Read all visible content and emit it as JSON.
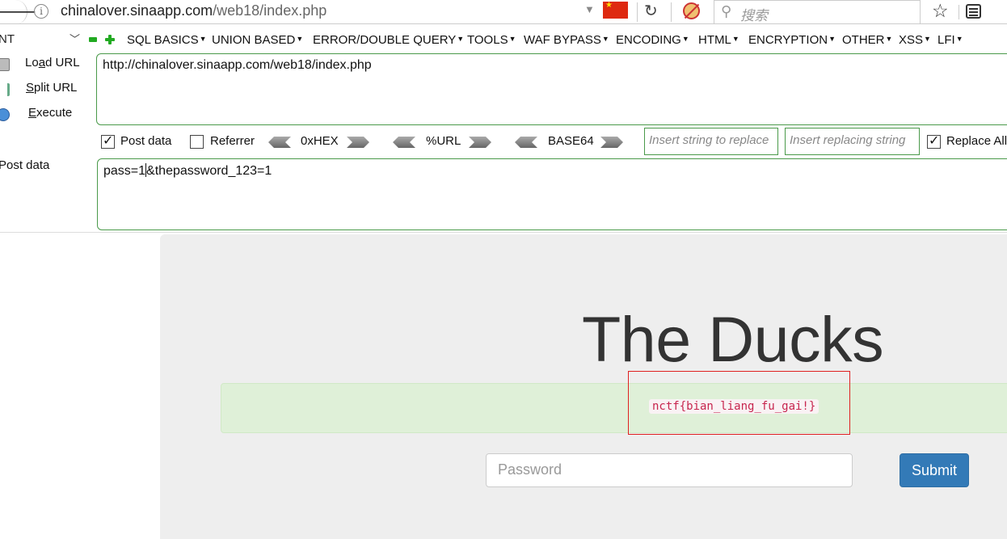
{
  "browser": {
    "url_host": "chinalover.sinaapp.com",
    "url_path": "/web18/index.php",
    "search_placeholder": "搜索"
  },
  "hackbar": {
    "select_value": "NT",
    "menus": [
      "SQL BASICS",
      "UNION BASED",
      "ERROR/DOUBLE QUERY",
      "TOOLS",
      "WAF BYPASS",
      "ENCODING",
      "HTML",
      "ENCRYPTION",
      "OTHER",
      "XSS",
      "LFI"
    ],
    "actions": {
      "load": {
        "pre": "Lo",
        "ul": "a",
        "post": "d URL"
      },
      "split": {
        "pre": "",
        "ul": "S",
        "post": "plit URL"
      },
      "execute": {
        "pre": "",
        "ul": "E",
        "post": "xecute"
      }
    },
    "url_value": "http://chinalover.sinaapp.com/web18/index.php",
    "options": {
      "post_data_label": "Post data",
      "post_data_checked": true,
      "referrer_label": "Referrer",
      "referrer_checked": false,
      "hex_label": "0xHEX",
      "url_label": "%URL",
      "base64_label": "BASE64",
      "replace_placeholder": "Insert string to replace",
      "replacing_placeholder": "Insert replacing string",
      "replace_all_label": "Replace All",
      "replace_all_checked": true
    },
    "post_label": "Post data",
    "post_value_before_caret": "pass=1",
    "post_value_after_caret": "&thepassword_123=1"
  },
  "page": {
    "title": "The Ducks",
    "flag": "nctf{bian_liang_fu_gai!}",
    "password_placeholder": "Password",
    "submit_label": "Submit"
  },
  "colors": {
    "accent_green": "#4a9a4a",
    "alert_bg": "#dff0d8",
    "flag_text": "#c7254e",
    "submit_bg": "#337ab7",
    "highlight_border": "#e02020"
  }
}
